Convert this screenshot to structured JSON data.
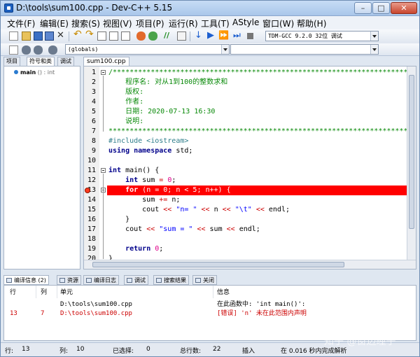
{
  "window": {
    "title": "D:\\tools\\sum100.cpp - Dev-C++ 5.15",
    "minimize": "–",
    "maximize": "□",
    "close": "✕"
  },
  "menu": [
    "文件(F)",
    "编辑(E)",
    "搜索(S)",
    "视图(V)",
    "项目(P)",
    "运行(R)",
    "工具(T)",
    "AStyle",
    "窗口(W)",
    "帮助(H)"
  ],
  "toolbar": {
    "compiler_select": "TDM-GCC 9.2.0 32位 调试",
    "scope_select": "(globals)",
    "member_select": ""
  },
  "left_panel": {
    "tabs": [
      "项目",
      "符号和类",
      "调试"
    ],
    "tree_item_name": "main",
    "tree_item_sig": " () : int"
  },
  "editor": {
    "file_tab": "sum100.cpp",
    "highlighted_line": 13,
    "lines": [
      {
        "n": "1",
        "t": [
          [
            "com",
            "/***************************************************************************"
          ]
        ]
      },
      {
        "n": "2",
        "t": [
          [
            "com",
            "    程序名: 对从1到100的整数求和"
          ]
        ]
      },
      {
        "n": "3",
        "t": [
          [
            "com",
            "    版权:"
          ]
        ]
      },
      {
        "n": "4",
        "t": [
          [
            "com",
            "    作者:"
          ]
        ]
      },
      {
        "n": "5",
        "t": [
          [
            "com",
            "    日期: 2020-07-13 16:30"
          ]
        ]
      },
      {
        "n": "6",
        "t": [
          [
            "com",
            "    说明:"
          ]
        ]
      },
      {
        "n": "7",
        "t": [
          [
            "com",
            "****************************************************************************/"
          ]
        ]
      },
      {
        "n": "8",
        "t": [
          [
            "pre",
            "#include <iostream>"
          ]
        ]
      },
      {
        "n": "9",
        "t": [
          [
            "kw",
            "using namespace"
          ],
          [
            "",
            " std;"
          ]
        ]
      },
      {
        "n": "10",
        "t": [
          [
            "",
            ""
          ]
        ]
      },
      {
        "n": "11",
        "t": [
          [
            "kw",
            "int"
          ],
          [
            "",
            " main() {"
          ]
        ]
      },
      {
        "n": "12",
        "t": [
          [
            "",
            "    "
          ],
          [
            "kw",
            "int"
          ],
          [
            "",
            " sum "
          ],
          [
            "op",
            "="
          ],
          [
            "",
            " "
          ],
          [
            "num",
            "0"
          ],
          [
            "",
            ";"
          ]
        ]
      },
      {
        "n": "13",
        "t": [
          [
            "",
            "    "
          ],
          [
            "kw",
            "for"
          ],
          [
            "",
            " (n = 0; n < 5; n++) {"
          ]
        ]
      },
      {
        "n": "14",
        "t": [
          [
            "",
            "        sum "
          ],
          [
            "op",
            "+="
          ],
          [
            "",
            " n;"
          ]
        ]
      },
      {
        "n": "15",
        "t": [
          [
            "",
            "        cout "
          ],
          [
            "op",
            "<<"
          ],
          [
            "",
            " "
          ],
          [
            "str",
            "\"n= \""
          ],
          [
            "",
            " "
          ],
          [
            "op",
            "<<"
          ],
          [
            "",
            " n "
          ],
          [
            "op",
            "<<"
          ],
          [
            "",
            " "
          ],
          [
            "str",
            "\"\\t\""
          ],
          [
            "",
            " "
          ],
          [
            "op",
            "<<"
          ],
          [
            "",
            " endl;"
          ]
        ]
      },
      {
        "n": "16",
        "t": [
          [
            "",
            "    }"
          ]
        ]
      },
      {
        "n": "17",
        "t": [
          [
            "",
            "    cout "
          ],
          [
            "op",
            "<<"
          ],
          [
            "",
            " "
          ],
          [
            "str",
            "\"sum = \""
          ],
          [
            "",
            " "
          ],
          [
            "op",
            "<<"
          ],
          [
            "",
            " sum "
          ],
          [
            "op",
            "<<"
          ],
          [
            "",
            " endl;"
          ]
        ]
      },
      {
        "n": "18",
        "t": [
          [
            "",
            ""
          ]
        ]
      },
      {
        "n": "19",
        "t": [
          [
            "",
            "    "
          ],
          [
            "kw",
            "return"
          ],
          [
            "",
            " "
          ],
          [
            "num",
            "0"
          ],
          [
            "",
            ";"
          ]
        ]
      },
      {
        "n": "20",
        "t": [
          [
            "",
            "}"
          ]
        ]
      }
    ]
  },
  "bottom": {
    "tabs": [
      "编译信息 (2)",
      "资源",
      "编译日志",
      "调试",
      "搜索结果",
      "关闭"
    ],
    "columns": [
      "行",
      "列",
      "单元",
      "信息"
    ],
    "messages": [
      {
        "line": "",
        "col": "",
        "unit": "D:\\tools\\sum100.cpp",
        "info": "在此函数中: 'int main()':",
        "error": false
      },
      {
        "line": "13",
        "col": "7",
        "unit": "D:\\tools\\sum100.cpp",
        "info": "[错误] 'n' 未在此范围内声明",
        "error": true
      }
    ]
  },
  "status": {
    "row_label": "行:",
    "row": "13",
    "col_label": "列:",
    "col": "10",
    "sel_label": "已选择:",
    "sel": "0",
    "total_label": "总行数:",
    "total": "22",
    "mode": "插入",
    "parse": "在 0.016 秒内完成解析"
  },
  "watermark": "知乎 @窗边瞳子",
  "colors": {
    "error_line": "#ff0000",
    "comment": "#0a8a0a",
    "keyword": "#00008b",
    "error_text": "#cc0000"
  }
}
